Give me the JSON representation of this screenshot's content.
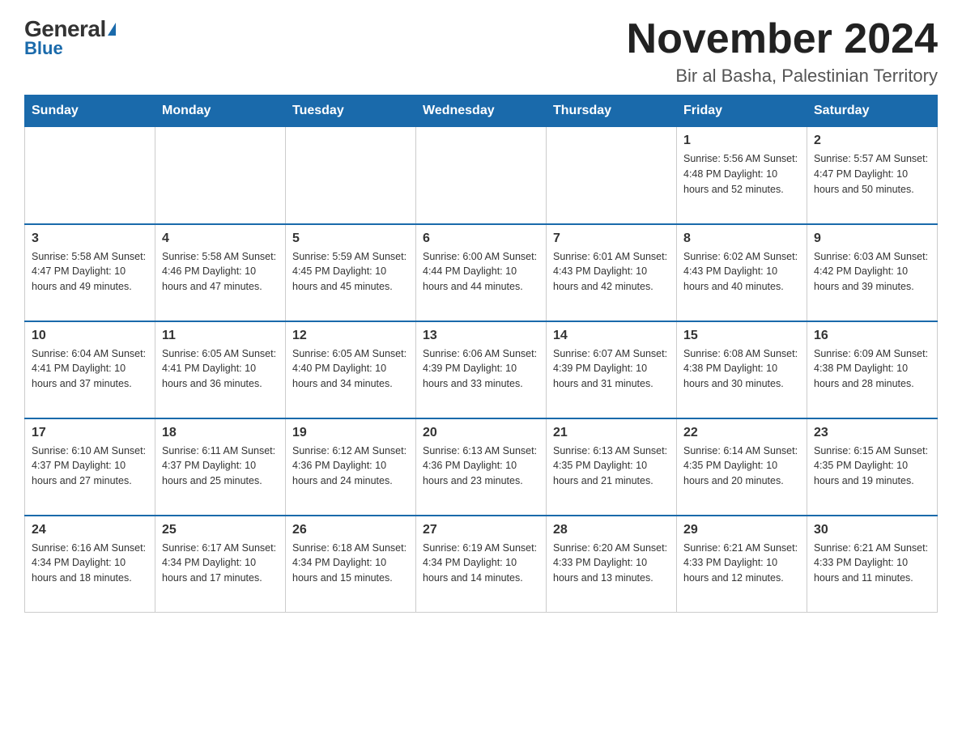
{
  "header": {
    "logo_general": "General",
    "logo_blue": "Blue",
    "month_year": "November 2024",
    "location": "Bir al Basha, Palestinian Territory"
  },
  "days_of_week": [
    "Sunday",
    "Monday",
    "Tuesday",
    "Wednesday",
    "Thursday",
    "Friday",
    "Saturday"
  ],
  "weeks": [
    [
      {
        "day": null,
        "info": null
      },
      {
        "day": null,
        "info": null
      },
      {
        "day": null,
        "info": null
      },
      {
        "day": null,
        "info": null
      },
      {
        "day": null,
        "info": null
      },
      {
        "day": "1",
        "info": "Sunrise: 5:56 AM\nSunset: 4:48 PM\nDaylight: 10 hours and 52 minutes."
      },
      {
        "day": "2",
        "info": "Sunrise: 5:57 AM\nSunset: 4:47 PM\nDaylight: 10 hours and 50 minutes."
      }
    ],
    [
      {
        "day": "3",
        "info": "Sunrise: 5:58 AM\nSunset: 4:47 PM\nDaylight: 10 hours and 49 minutes."
      },
      {
        "day": "4",
        "info": "Sunrise: 5:58 AM\nSunset: 4:46 PM\nDaylight: 10 hours and 47 minutes."
      },
      {
        "day": "5",
        "info": "Sunrise: 5:59 AM\nSunset: 4:45 PM\nDaylight: 10 hours and 45 minutes."
      },
      {
        "day": "6",
        "info": "Sunrise: 6:00 AM\nSunset: 4:44 PM\nDaylight: 10 hours and 44 minutes."
      },
      {
        "day": "7",
        "info": "Sunrise: 6:01 AM\nSunset: 4:43 PM\nDaylight: 10 hours and 42 minutes."
      },
      {
        "day": "8",
        "info": "Sunrise: 6:02 AM\nSunset: 4:43 PM\nDaylight: 10 hours and 40 minutes."
      },
      {
        "day": "9",
        "info": "Sunrise: 6:03 AM\nSunset: 4:42 PM\nDaylight: 10 hours and 39 minutes."
      }
    ],
    [
      {
        "day": "10",
        "info": "Sunrise: 6:04 AM\nSunset: 4:41 PM\nDaylight: 10 hours and 37 minutes."
      },
      {
        "day": "11",
        "info": "Sunrise: 6:05 AM\nSunset: 4:41 PM\nDaylight: 10 hours and 36 minutes."
      },
      {
        "day": "12",
        "info": "Sunrise: 6:05 AM\nSunset: 4:40 PM\nDaylight: 10 hours and 34 minutes."
      },
      {
        "day": "13",
        "info": "Sunrise: 6:06 AM\nSunset: 4:39 PM\nDaylight: 10 hours and 33 minutes."
      },
      {
        "day": "14",
        "info": "Sunrise: 6:07 AM\nSunset: 4:39 PM\nDaylight: 10 hours and 31 minutes."
      },
      {
        "day": "15",
        "info": "Sunrise: 6:08 AM\nSunset: 4:38 PM\nDaylight: 10 hours and 30 minutes."
      },
      {
        "day": "16",
        "info": "Sunrise: 6:09 AM\nSunset: 4:38 PM\nDaylight: 10 hours and 28 minutes."
      }
    ],
    [
      {
        "day": "17",
        "info": "Sunrise: 6:10 AM\nSunset: 4:37 PM\nDaylight: 10 hours and 27 minutes."
      },
      {
        "day": "18",
        "info": "Sunrise: 6:11 AM\nSunset: 4:37 PM\nDaylight: 10 hours and 25 minutes."
      },
      {
        "day": "19",
        "info": "Sunrise: 6:12 AM\nSunset: 4:36 PM\nDaylight: 10 hours and 24 minutes."
      },
      {
        "day": "20",
        "info": "Sunrise: 6:13 AM\nSunset: 4:36 PM\nDaylight: 10 hours and 23 minutes."
      },
      {
        "day": "21",
        "info": "Sunrise: 6:13 AM\nSunset: 4:35 PM\nDaylight: 10 hours and 21 minutes."
      },
      {
        "day": "22",
        "info": "Sunrise: 6:14 AM\nSunset: 4:35 PM\nDaylight: 10 hours and 20 minutes."
      },
      {
        "day": "23",
        "info": "Sunrise: 6:15 AM\nSunset: 4:35 PM\nDaylight: 10 hours and 19 minutes."
      }
    ],
    [
      {
        "day": "24",
        "info": "Sunrise: 6:16 AM\nSunset: 4:34 PM\nDaylight: 10 hours and 18 minutes."
      },
      {
        "day": "25",
        "info": "Sunrise: 6:17 AM\nSunset: 4:34 PM\nDaylight: 10 hours and 17 minutes."
      },
      {
        "day": "26",
        "info": "Sunrise: 6:18 AM\nSunset: 4:34 PM\nDaylight: 10 hours and 15 minutes."
      },
      {
        "day": "27",
        "info": "Sunrise: 6:19 AM\nSunset: 4:34 PM\nDaylight: 10 hours and 14 minutes."
      },
      {
        "day": "28",
        "info": "Sunrise: 6:20 AM\nSunset: 4:33 PM\nDaylight: 10 hours and 13 minutes."
      },
      {
        "day": "29",
        "info": "Sunrise: 6:21 AM\nSunset: 4:33 PM\nDaylight: 10 hours and 12 minutes."
      },
      {
        "day": "30",
        "info": "Sunrise: 6:21 AM\nSunset: 4:33 PM\nDaylight: 10 hours and 11 minutes."
      }
    ]
  ]
}
